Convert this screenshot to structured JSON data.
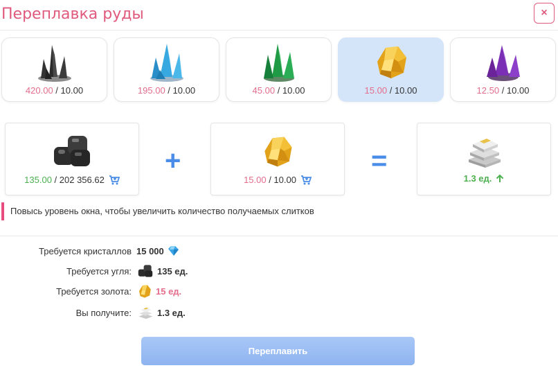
{
  "window": {
    "title": "Переплавка руды",
    "close_label": "×"
  },
  "ores": [
    {
      "icon": "black-crystal-icon",
      "have": "420.00",
      "need": "10.00",
      "selected": false
    },
    {
      "icon": "blue-crystal-icon",
      "have": "195.00",
      "need": "10.00",
      "selected": false
    },
    {
      "icon": "green-crystal-icon",
      "have": "45.00",
      "need": "10.00",
      "selected": false
    },
    {
      "icon": "gold-ore-icon",
      "have": "15.00",
      "need": "10.00",
      "selected": true
    },
    {
      "icon": "purple-crystal-icon",
      "have": "12.50",
      "need": "10.00",
      "selected": false
    }
  ],
  "recipe": {
    "coal": {
      "have": "135.00",
      "total": "202 356.62"
    },
    "plus": "+",
    "ore": {
      "have": "15.00",
      "need": "10.00"
    },
    "equals": "=",
    "result": {
      "value": "1.3 ед."
    }
  },
  "hint": "Повысь уровень окна, чтобы увеличить количество получаемых слитков",
  "requirements": [
    {
      "label": "Требуется кристаллов",
      "value": "15 000",
      "icon": "blue-gem-icon"
    },
    {
      "label": "Требуется угля:",
      "value": "135 ед.",
      "icon": "coal-icon"
    },
    {
      "label": "Требуется золота:",
      "value": "15 ед.",
      "icon": "gold-ore-icon"
    },
    {
      "label": "Вы получите:",
      "value": "1.3 ед.",
      "icon": "ingot-icon"
    }
  ],
  "smelt_button": "Переплавить",
  "colors": {
    "accent_pink": "#e05a7d",
    "accent_blue": "#4a8de8",
    "selected_bg": "#d4e4f9",
    "green": "#4caf50"
  }
}
